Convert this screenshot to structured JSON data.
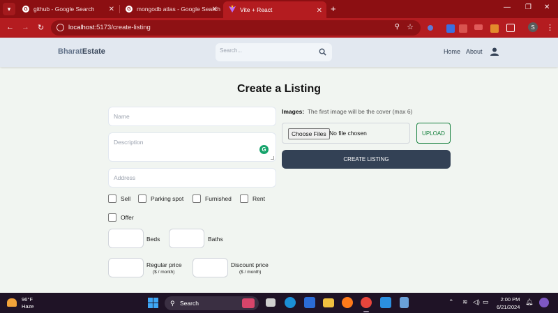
{
  "browser": {
    "tabs": [
      {
        "title": "github - Google Search"
      },
      {
        "title": "mongodb atlas - Google Search"
      },
      {
        "title": "Vite + React"
      }
    ],
    "url_host": "localhost",
    "url_path": ":5173/create-listing",
    "profile_initial": "S"
  },
  "header": {
    "brand_part1": "Bharat",
    "brand_part2": "Estate",
    "search_placeholder": "Search...",
    "nav_home": "Home",
    "nav_about": "About"
  },
  "form": {
    "title": "Create a Listing",
    "name_placeholder": "Name",
    "description_placeholder": "Description",
    "address_placeholder": "Address",
    "checkboxes": {
      "sell": "Sell",
      "parking": "Parking spot",
      "furnished": "Furnished",
      "rent": "Rent",
      "offer": "Offer"
    },
    "beds_label": "Beds",
    "baths_label": "Baths",
    "regular_price_label": "Regular price",
    "regular_price_unit": "($ / month)",
    "discount_price_label": "Discount price",
    "discount_price_unit": "($ / month)",
    "images_label": "Images:",
    "images_note": "The first image will be the cover (max 6)",
    "choose_files": "Choose Files",
    "no_file": "No file chosen",
    "upload_button": "UPLOAD",
    "create_button": "CREATE LISTING"
  },
  "taskbar": {
    "temperature": "96°F",
    "condition": "Haze",
    "search_label": "Search",
    "time": "2:00 PM",
    "date": "6/21/2024"
  },
  "colors": {
    "chrome_tabstrip": "#8c0f12",
    "chrome_toolbar": "#b41c20",
    "header_bg": "#e2e8f0",
    "page_bg": "#f1f5f1",
    "create_button": "#334155",
    "upload_accent": "#15803d"
  }
}
